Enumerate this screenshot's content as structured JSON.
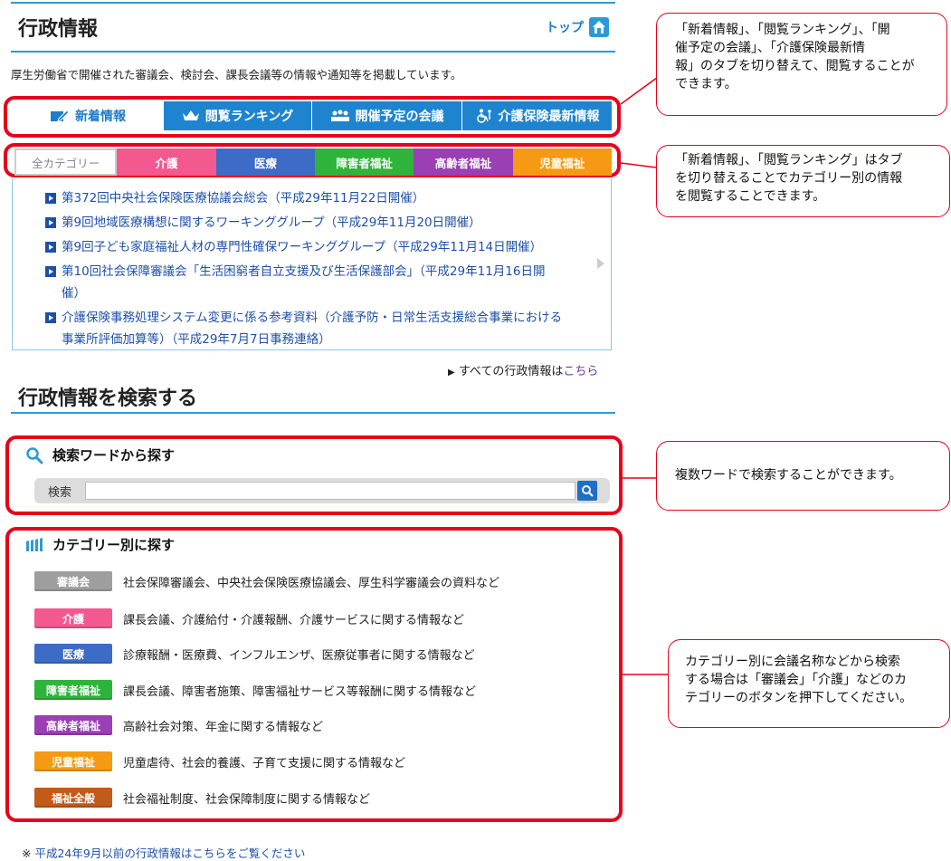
{
  "header": {
    "title": "行政情報",
    "top_link": "トップ",
    "intro": "厚生労働省で開催された審議会、検討会、課長会議等の情報や通知等を掲載しています。"
  },
  "tabs": [
    {
      "label": "新着情報",
      "icon": "pencil-icon",
      "active": true
    },
    {
      "label": "閲覧ランキング",
      "icon": "crown-icon",
      "active": false
    },
    {
      "label": "開催予定の会議",
      "icon": "meeting-icon",
      "active": false
    },
    {
      "label": "介護保険最新情報",
      "icon": "wheelchair-icon",
      "active": false
    }
  ],
  "categories": [
    {
      "label": "全カテゴリー",
      "color": "#ffffff"
    },
    {
      "label": "介護",
      "color": "#f3588f"
    },
    {
      "label": "医療",
      "color": "#3d6cc6"
    },
    {
      "label": "障害者福祉",
      "color": "#2eb43a"
    },
    {
      "label": "高齢者福祉",
      "color": "#9b3fb5"
    },
    {
      "label": "児童福祉",
      "color": "#f59a12"
    }
  ],
  "news": [
    {
      "lines": [
        "第372回中央社会保険医療協議会総会（平成29年11月22日開催）"
      ]
    },
    {
      "lines": [
        "第9回地域医療構想に関するワーキンググループ（平成29年11月20日開催）"
      ]
    },
    {
      "lines": [
        "第9回子ども家庭福祉人材の専門性確保ワーキンググループ（平成29年11月14日開催）"
      ]
    },
    {
      "lines": [
        "第10回社会保障審議会「生活困窮者自立支援及び生活保護部会」（平成29年11月16日開",
        "催）"
      ]
    },
    {
      "lines": [
        "介護保険事務処理システム変更に係る参考資料（介護予防・日常生活支援総合事業における",
        "事業所評価加算等）（平成29年7月7日事務連絡）"
      ]
    }
  ],
  "all_link": {
    "prefix": "すべての行政情報は",
    "link": "こちら"
  },
  "search_section": {
    "title": "行政情報を検索する",
    "keyword_heading": "検索ワードから探す",
    "search_label": "検索",
    "search_value": "",
    "category_heading": "カテゴリー別に探す"
  },
  "category_list": [
    {
      "label": "審議会",
      "color": "#9e9e9e",
      "desc": "社会保障審議会、中央社会保険医療協議会、厚生科学審議会の資料など"
    },
    {
      "label": "介護",
      "color": "#f3588f",
      "desc": "課長会議、介護給付・介護報酬、介護サービスに関する情報など"
    },
    {
      "label": "医療",
      "color": "#3d6cc6",
      "desc": "診療報酬・医療費、インフルエンザ、医療従事者に関する情報など"
    },
    {
      "label": "障害者福祉",
      "color": "#2eb43a",
      "desc": "課長会議、障害者施策、障害福祉サービス等報酬に関する情報など"
    },
    {
      "label": "高齢者福祉",
      "color": "#9b3fb5",
      "desc": "高齢社会対策、年金に関する情報など"
    },
    {
      "label": "児童福祉",
      "color": "#f59a12",
      "desc": "児童虐待、社会的養護、子育て支援に関する情報など"
    },
    {
      "label": "福祉全般",
      "color": "#c25a1a",
      "desc": "社会福祉制度、社会保障制度に関する情報など"
    }
  ],
  "footer": {
    "mark": "※",
    "link": "平成24年9月以前の行政情報はこちらをご覧ください"
  },
  "callouts": [
    {
      "lines": [
        "「新着情報」、「閲覧ランキング」、「開",
        "催予定の会議」、「介護保険最新情",
        "報」のタブを切り替えて、閲覧することが",
        "できます。"
      ]
    },
    {
      "lines": [
        "「新着情報」、「閲覧ランキング」はタブ",
        "を切り替えることでカテゴリー別の情報",
        "を閲覧することできます。"
      ]
    },
    {
      "lines": [
        "複数ワードで検索することができます。"
      ]
    },
    {
      "lines": [
        "カテゴリー別に会議名称などから検索",
        "する場合は「審議会」「介護」などのカ",
        "テゴリーのボタンを押下してください。"
      ]
    }
  ]
}
